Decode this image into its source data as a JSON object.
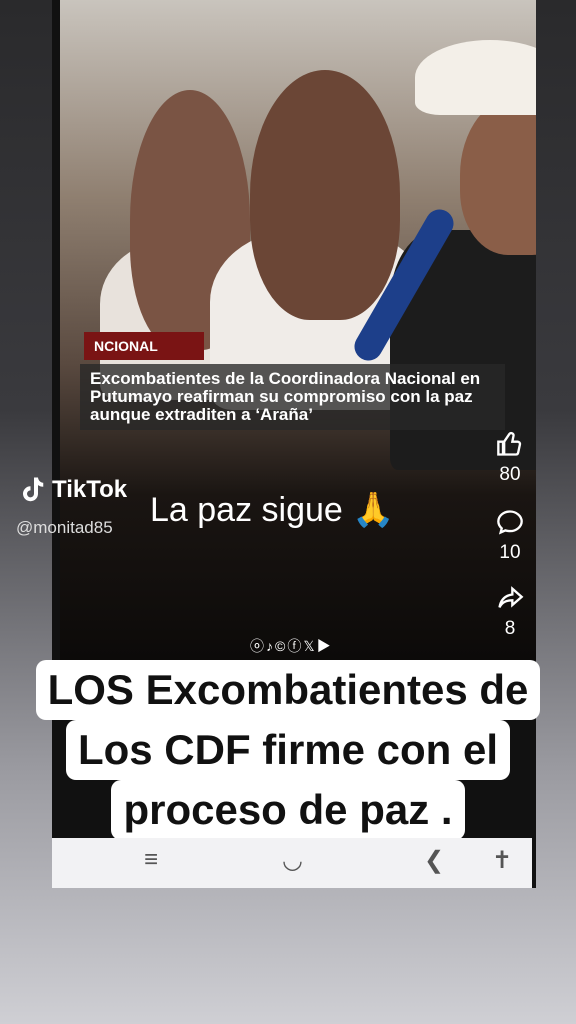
{
  "news": {
    "tag": "NCIONAL",
    "headline": "Excombatientes de la Coordinadora Nacional en Putumayo reafirman su compromiso con la paz aunque extraditen a ‘Araña’"
  },
  "social_icons": "ⓞ♪©ⓕ𝕏▶",
  "actions": {
    "likes": "80",
    "comments": "10",
    "shares": "8"
  },
  "tiktok": {
    "brand": "TikTok",
    "username": "@monitad85"
  },
  "captions": {
    "top": "La paz sigue 🙏",
    "main_lines": [
      "LOS Excombatientes de",
      "Los CDF firme con el",
      "proceso de paz ."
    ]
  },
  "navbar": {
    "menu": "≡",
    "home": "◡",
    "back": "❮",
    "accessibility": "✝"
  }
}
